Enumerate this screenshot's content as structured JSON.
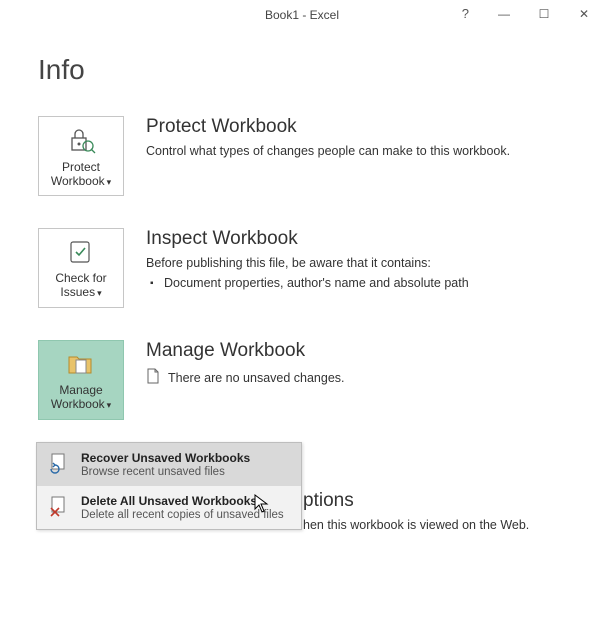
{
  "titlebar": {
    "title": "Book1 - Excel",
    "help": "?",
    "minimize": "—",
    "maximize": "☐",
    "close": "✕"
  },
  "page_title": "Info",
  "protect": {
    "button_label": "Protect Workbook",
    "heading": "Protect Workbook",
    "desc": "Control what types of changes people can make to this workbook."
  },
  "inspect": {
    "button_label": "Check for Issues",
    "heading": "Inspect Workbook",
    "desc": "Before publishing this file, be aware that it contains:",
    "bullet1": "Document properties, author's name and absolute path"
  },
  "manage": {
    "button_label": "Manage Workbook",
    "heading": "Manage Workbook",
    "status": "There are no unsaved changes."
  },
  "browser": {
    "heading_fragment": "ptions",
    "desc_fragment": "hen this workbook is viewed on the Web."
  },
  "menu": {
    "recover_title": "Recover Unsaved Workbooks",
    "recover_sub": "Browse recent unsaved files",
    "delete_title": "Delete All Unsaved Workbooks",
    "delete_sub": "Delete all recent copies of unsaved files"
  }
}
